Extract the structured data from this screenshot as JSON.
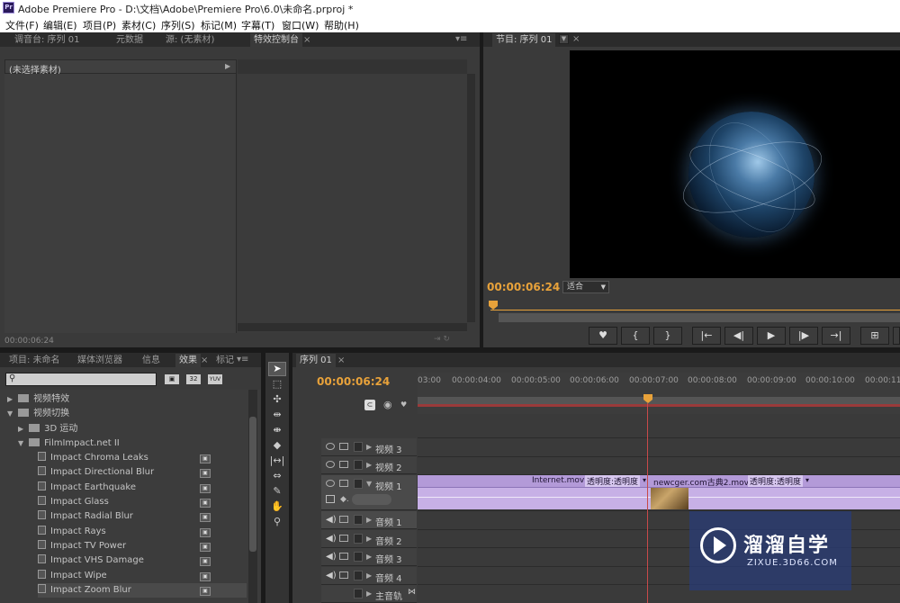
{
  "window": {
    "title": "Adobe Premiere Pro - D:\\文档\\Adobe\\Premiere Pro\\6.0\\未命名.prproj *",
    "logo": "Pr"
  },
  "menu": [
    "文件(F)",
    "编辑(E)",
    "项目(P)",
    "素材(C)",
    "序列(S)",
    "标记(M)",
    "字幕(T)",
    "窗口(W)",
    "帮助(H)"
  ],
  "source_panel": {
    "tabs": [
      "调音台: 序列 01",
      "元数据",
      "源: (无素材)",
      "特效控制台"
    ],
    "no_clip": "(未选择素材)",
    "timecode": "00:00:06:24"
  },
  "program": {
    "tab": "节目: 序列 01",
    "timecode": "00:00:06:24",
    "fit": "适合"
  },
  "project_panel": {
    "tabs": [
      "项目: 未命名",
      "媒体浏览器",
      "信息",
      "效果",
      "标记"
    ],
    "badges": [
      "32",
      "YUV"
    ],
    "tree": [
      {
        "label": "视频特效",
        "level": 0,
        "type": "folder",
        "open": false
      },
      {
        "label": "视频切换",
        "level": 0,
        "type": "folder",
        "open": true
      },
      {
        "label": "3D 运动",
        "level": 1,
        "type": "folder",
        "open": false
      },
      {
        "label": "FilmImpact.net II",
        "level": 1,
        "type": "folder",
        "open": true
      },
      {
        "label": "Impact Chroma Leaks",
        "level": 2,
        "type": "fx"
      },
      {
        "label": "Impact Directional Blur",
        "level": 2,
        "type": "fx"
      },
      {
        "label": "Impact Earthquake",
        "level": 2,
        "type": "fx"
      },
      {
        "label": "Impact Glass",
        "level": 2,
        "type": "fx"
      },
      {
        "label": "Impact Radial Blur",
        "level": 2,
        "type": "fx"
      },
      {
        "label": "Impact Rays",
        "level": 2,
        "type": "fx"
      },
      {
        "label": "Impact TV Power",
        "level": 2,
        "type": "fx"
      },
      {
        "label": "Impact VHS Damage",
        "level": 2,
        "type": "fx"
      },
      {
        "label": "Impact Wipe",
        "level": 2,
        "type": "fx"
      },
      {
        "label": "Impact Zoom Blur",
        "level": 2,
        "type": "fx"
      }
    ]
  },
  "timeline": {
    "tab": "序列 01",
    "timecode": "00:00:06:24",
    "ruler": [
      "03:00",
      "00:00:04:00",
      "00:00:05:00",
      "00:00:06:00",
      "00:00:07:00",
      "00:00:08:00",
      "00:00:09:00",
      "00:00:10:00",
      "00:00:11:0"
    ],
    "video_tracks": [
      "视频 3",
      "视频 2",
      "视频 1"
    ],
    "audio_tracks": [
      "音频 1",
      "音频 2",
      "音频 3",
      "音频 4"
    ],
    "master": "主音轨",
    "clips": [
      {
        "name": "Internet.mov",
        "fx": "透明度:透明度"
      },
      {
        "name": "newcger.com古典2.mov",
        "fx": "透明度:透明度"
      }
    ]
  },
  "watermark": {
    "brand": "溜溜自学",
    "url": "ZIXUE.3D66.COM"
  },
  "colors": {
    "accent": "#e8a23a",
    "clip": "#b8a0d8",
    "playhead": "#c84a4a"
  }
}
